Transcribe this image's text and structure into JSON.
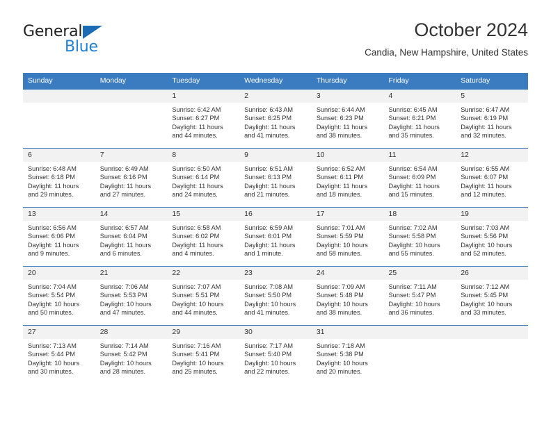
{
  "brand": {
    "name_part1": "General",
    "name_part2": "Blue",
    "triangle_color": "#1b6cb5",
    "blue_color": "#1f7fd4"
  },
  "header": {
    "title": "October 2024",
    "subtitle": "Candia, New Hampshire, United States"
  },
  "theme": {
    "header_bg": "#3b7bbf",
    "daynum_bg": "#f2f2f2",
    "text": "#333333"
  },
  "weekdays": [
    "Sunday",
    "Monday",
    "Tuesday",
    "Wednesday",
    "Thursday",
    "Friday",
    "Saturday"
  ],
  "weeks": [
    [
      {
        "day": "",
        "sunrise": "",
        "sunset": "",
        "daylight1": "",
        "daylight2": ""
      },
      {
        "day": "",
        "sunrise": "",
        "sunset": "",
        "daylight1": "",
        "daylight2": ""
      },
      {
        "day": "1",
        "sunrise": "Sunrise: 6:42 AM",
        "sunset": "Sunset: 6:27 PM",
        "daylight1": "Daylight: 11 hours",
        "daylight2": "and 44 minutes."
      },
      {
        "day": "2",
        "sunrise": "Sunrise: 6:43 AM",
        "sunset": "Sunset: 6:25 PM",
        "daylight1": "Daylight: 11 hours",
        "daylight2": "and 41 minutes."
      },
      {
        "day": "3",
        "sunrise": "Sunrise: 6:44 AM",
        "sunset": "Sunset: 6:23 PM",
        "daylight1": "Daylight: 11 hours",
        "daylight2": "and 38 minutes."
      },
      {
        "day": "4",
        "sunrise": "Sunrise: 6:45 AM",
        "sunset": "Sunset: 6:21 PM",
        "daylight1": "Daylight: 11 hours",
        "daylight2": "and 35 minutes."
      },
      {
        "day": "5",
        "sunrise": "Sunrise: 6:47 AM",
        "sunset": "Sunset: 6:19 PM",
        "daylight1": "Daylight: 11 hours",
        "daylight2": "and 32 minutes."
      }
    ],
    [
      {
        "day": "6",
        "sunrise": "Sunrise: 6:48 AM",
        "sunset": "Sunset: 6:18 PM",
        "daylight1": "Daylight: 11 hours",
        "daylight2": "and 29 minutes."
      },
      {
        "day": "7",
        "sunrise": "Sunrise: 6:49 AM",
        "sunset": "Sunset: 6:16 PM",
        "daylight1": "Daylight: 11 hours",
        "daylight2": "and 27 minutes."
      },
      {
        "day": "8",
        "sunrise": "Sunrise: 6:50 AM",
        "sunset": "Sunset: 6:14 PM",
        "daylight1": "Daylight: 11 hours",
        "daylight2": "and 24 minutes."
      },
      {
        "day": "9",
        "sunrise": "Sunrise: 6:51 AM",
        "sunset": "Sunset: 6:13 PM",
        "daylight1": "Daylight: 11 hours",
        "daylight2": "and 21 minutes."
      },
      {
        "day": "10",
        "sunrise": "Sunrise: 6:52 AM",
        "sunset": "Sunset: 6:11 PM",
        "daylight1": "Daylight: 11 hours",
        "daylight2": "and 18 minutes."
      },
      {
        "day": "11",
        "sunrise": "Sunrise: 6:54 AM",
        "sunset": "Sunset: 6:09 PM",
        "daylight1": "Daylight: 11 hours",
        "daylight2": "and 15 minutes."
      },
      {
        "day": "12",
        "sunrise": "Sunrise: 6:55 AM",
        "sunset": "Sunset: 6:07 PM",
        "daylight1": "Daylight: 11 hours",
        "daylight2": "and 12 minutes."
      }
    ],
    [
      {
        "day": "13",
        "sunrise": "Sunrise: 6:56 AM",
        "sunset": "Sunset: 6:06 PM",
        "daylight1": "Daylight: 11 hours",
        "daylight2": "and 9 minutes."
      },
      {
        "day": "14",
        "sunrise": "Sunrise: 6:57 AM",
        "sunset": "Sunset: 6:04 PM",
        "daylight1": "Daylight: 11 hours",
        "daylight2": "and 6 minutes."
      },
      {
        "day": "15",
        "sunrise": "Sunrise: 6:58 AM",
        "sunset": "Sunset: 6:02 PM",
        "daylight1": "Daylight: 11 hours",
        "daylight2": "and 4 minutes."
      },
      {
        "day": "16",
        "sunrise": "Sunrise: 6:59 AM",
        "sunset": "Sunset: 6:01 PM",
        "daylight1": "Daylight: 11 hours",
        "daylight2": "and 1 minute."
      },
      {
        "day": "17",
        "sunrise": "Sunrise: 7:01 AM",
        "sunset": "Sunset: 5:59 PM",
        "daylight1": "Daylight: 10 hours",
        "daylight2": "and 58 minutes."
      },
      {
        "day": "18",
        "sunrise": "Sunrise: 7:02 AM",
        "sunset": "Sunset: 5:58 PM",
        "daylight1": "Daylight: 10 hours",
        "daylight2": "and 55 minutes."
      },
      {
        "day": "19",
        "sunrise": "Sunrise: 7:03 AM",
        "sunset": "Sunset: 5:56 PM",
        "daylight1": "Daylight: 10 hours",
        "daylight2": "and 52 minutes."
      }
    ],
    [
      {
        "day": "20",
        "sunrise": "Sunrise: 7:04 AM",
        "sunset": "Sunset: 5:54 PM",
        "daylight1": "Daylight: 10 hours",
        "daylight2": "and 50 minutes."
      },
      {
        "day": "21",
        "sunrise": "Sunrise: 7:06 AM",
        "sunset": "Sunset: 5:53 PM",
        "daylight1": "Daylight: 10 hours",
        "daylight2": "and 47 minutes."
      },
      {
        "day": "22",
        "sunrise": "Sunrise: 7:07 AM",
        "sunset": "Sunset: 5:51 PM",
        "daylight1": "Daylight: 10 hours",
        "daylight2": "and 44 minutes."
      },
      {
        "day": "23",
        "sunrise": "Sunrise: 7:08 AM",
        "sunset": "Sunset: 5:50 PM",
        "daylight1": "Daylight: 10 hours",
        "daylight2": "and 41 minutes."
      },
      {
        "day": "24",
        "sunrise": "Sunrise: 7:09 AM",
        "sunset": "Sunset: 5:48 PM",
        "daylight1": "Daylight: 10 hours",
        "daylight2": "and 38 minutes."
      },
      {
        "day": "25",
        "sunrise": "Sunrise: 7:11 AM",
        "sunset": "Sunset: 5:47 PM",
        "daylight1": "Daylight: 10 hours",
        "daylight2": "and 36 minutes."
      },
      {
        "day": "26",
        "sunrise": "Sunrise: 7:12 AM",
        "sunset": "Sunset: 5:45 PM",
        "daylight1": "Daylight: 10 hours",
        "daylight2": "and 33 minutes."
      }
    ],
    [
      {
        "day": "27",
        "sunrise": "Sunrise: 7:13 AM",
        "sunset": "Sunset: 5:44 PM",
        "daylight1": "Daylight: 10 hours",
        "daylight2": "and 30 minutes."
      },
      {
        "day": "28",
        "sunrise": "Sunrise: 7:14 AM",
        "sunset": "Sunset: 5:42 PM",
        "daylight1": "Daylight: 10 hours",
        "daylight2": "and 28 minutes."
      },
      {
        "day": "29",
        "sunrise": "Sunrise: 7:16 AM",
        "sunset": "Sunset: 5:41 PM",
        "daylight1": "Daylight: 10 hours",
        "daylight2": "and 25 minutes."
      },
      {
        "day": "30",
        "sunrise": "Sunrise: 7:17 AM",
        "sunset": "Sunset: 5:40 PM",
        "daylight1": "Daylight: 10 hours",
        "daylight2": "and 22 minutes."
      },
      {
        "day": "31",
        "sunrise": "Sunrise: 7:18 AM",
        "sunset": "Sunset: 5:38 PM",
        "daylight1": "Daylight: 10 hours",
        "daylight2": "and 20 minutes."
      },
      {
        "day": "",
        "sunrise": "",
        "sunset": "",
        "daylight1": "",
        "daylight2": ""
      },
      {
        "day": "",
        "sunrise": "",
        "sunset": "",
        "daylight1": "",
        "daylight2": ""
      }
    ]
  ]
}
